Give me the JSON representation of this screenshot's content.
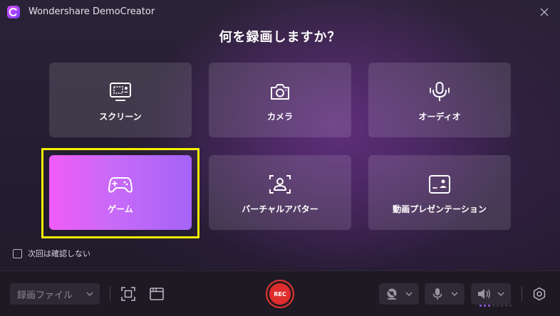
{
  "app": {
    "title": "Wondershare DemoCreator",
    "close_icon": "close-icon"
  },
  "heading": "何を録画しますか？",
  "tiles": [
    {
      "label": "スクリーン",
      "icon": "screen-record-icon",
      "selected": false
    },
    {
      "label": "カメラ",
      "icon": "camera-icon",
      "selected": false
    },
    {
      "label": "オーディオ",
      "icon": "microphone-icon",
      "selected": false
    },
    {
      "label": "ゲーム",
      "icon": "gamepad-icon",
      "selected": true
    },
    {
      "label": "バーチャルアバター",
      "icon": "avatar-frame-icon",
      "selected": false
    },
    {
      "label": "動画プレゼンテーション",
      "icon": "presentation-icon",
      "selected": false
    }
  ],
  "dont_show_again": {
    "label": "次回は確認しない",
    "checked": false
  },
  "toolbar": {
    "mode_select_value": "録画ファイル",
    "rec_label": "REC",
    "icons": [
      "region-select-icon",
      "window-icon",
      "webcam-icon",
      "microphone-icon",
      "speaker-icon",
      "settings-icon"
    ]
  },
  "colors": {
    "accent_gradient_start": "#f05cf7",
    "accent_gradient_end": "#a463f6",
    "highlight_border": "#f5f000",
    "rec_red": "#e02d2d"
  }
}
